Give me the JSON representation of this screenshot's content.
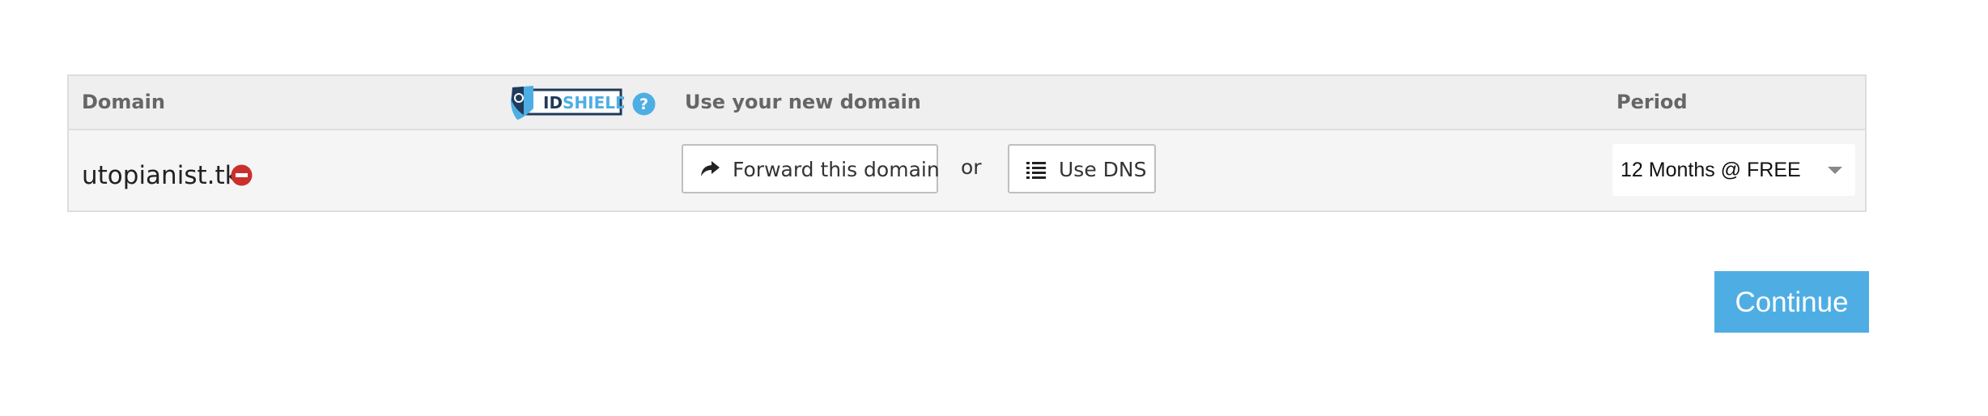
{
  "table": {
    "headers": {
      "domain": "Domain",
      "idshield_logo_text_id": "ID",
      "idshield_logo_text_shield": "SHIELD",
      "use_new_domain": "Use your new domain",
      "period": "Period"
    },
    "row": {
      "domain_name": "utopianist.tk",
      "forward_button_label": "Forward this domain",
      "or_text": "or",
      "dns_button_label": "Use DNS",
      "period_selected": "12 Months @ FREE"
    }
  },
  "actions": {
    "continue_label": "Continue"
  },
  "colors": {
    "accent": "#4eaee4",
    "remove": "#c9302c",
    "help": "#4eaee4",
    "idshield_dark": "#1f3a5a"
  },
  "icons": {
    "help": "help-circle-icon",
    "remove": "minus-circle-icon",
    "forward": "share-arrow-icon",
    "dns": "list-icon",
    "dropdown": "caret-down-icon"
  }
}
